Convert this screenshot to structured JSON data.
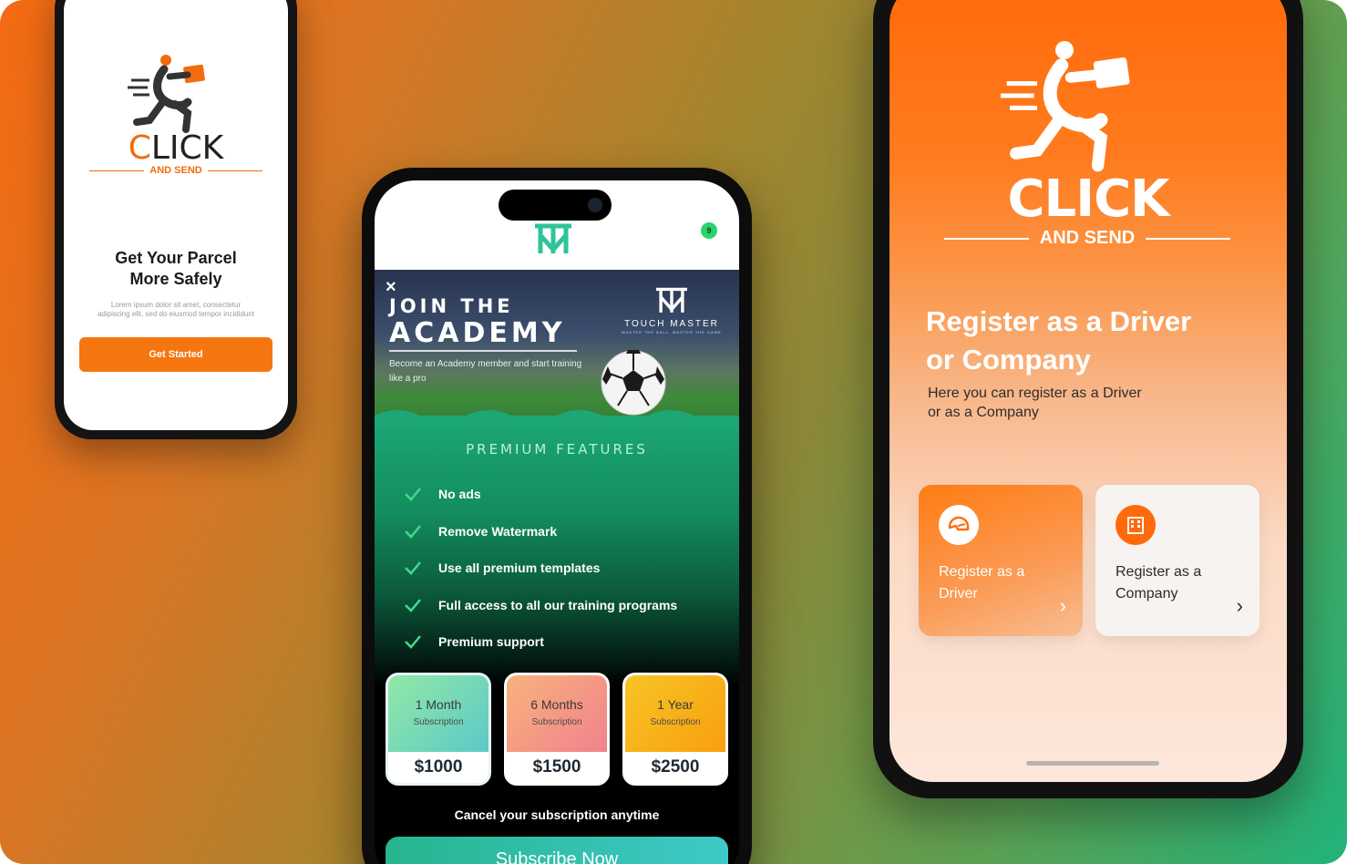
{
  "background": {
    "gradient_start": "#f46a12",
    "gradient_end": "#21b37a"
  },
  "phone_left": {
    "brand": {
      "click_first": "C",
      "click_rest": "LICK",
      "and_send": "AND SEND"
    },
    "title_line1": "Get Your Parcel",
    "title_line2": "More Safely",
    "description": "Lorem ipsum dolor sit amet, consectetur adipiscing elit, sed do eiusmod tempor incididunt",
    "cta_label": "Get Started",
    "accent": "#f5760f"
  },
  "phone_center": {
    "notification_count": "9",
    "hero": {
      "close_icon": "×",
      "line1": "JOIN THE",
      "line2": "ACADEMY",
      "brand_name": "TOUCH MASTER",
      "brand_tagline": "MASTER THE BALL, MASTER THE GAME",
      "description": "Become an Academy member and start training like a pro"
    },
    "features_title": "PREMIUM FEATURES",
    "features": [
      "No ads",
      "Remove Watermark",
      "Use all premium templates",
      "Full access to all our training programs",
      "Premium support"
    ],
    "plans": [
      {
        "name": "1 Month",
        "sub": "Subscription",
        "price": "$1000"
      },
      {
        "name": "6 Months",
        "sub": "Subscription",
        "price": "$1500"
      },
      {
        "name": "1 Year",
        "sub": "Subscription",
        "price": "$2500"
      }
    ],
    "cancel_note": "Cancel your subscription anytime",
    "subscribe_label": "Subscribe Now",
    "accent": "#1da776"
  },
  "phone_right": {
    "brand": {
      "click_first": "C",
      "click_rest": "LICK",
      "and_send": "AND SEND"
    },
    "title_line1": "Register as a Driver",
    "title_line2": "or Company",
    "desc_line1": "Here you can register as a Driver",
    "desc_line2": "or as a Company",
    "cards": [
      {
        "line1": "Register as a",
        "line2": "Driver",
        "icon": "helmet-icon"
      },
      {
        "line1": "Register as a",
        "line2": "Company",
        "icon": "building-icon"
      }
    ],
    "accent": "#ff6a0a"
  }
}
